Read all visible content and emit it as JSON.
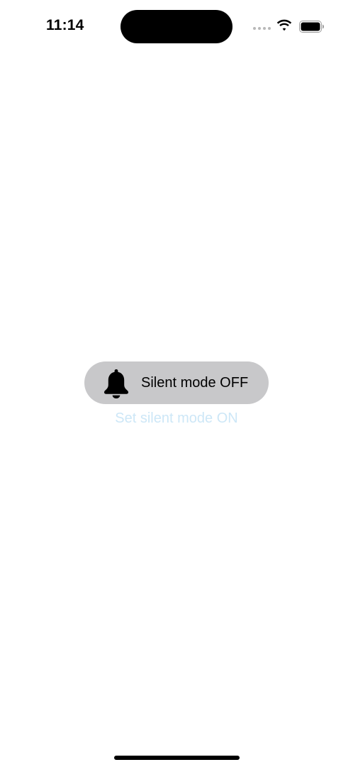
{
  "status_bar": {
    "time": "11:14",
    "icons": [
      "signal-dots-icon",
      "wifi-icon",
      "battery-icon"
    ]
  },
  "toast": {
    "icon": "bell-icon",
    "label": "Silent mode OFF",
    "background": "#c8c8ca"
  },
  "action": {
    "label": "Set silent mode ON",
    "color": "#cde7f7"
  }
}
